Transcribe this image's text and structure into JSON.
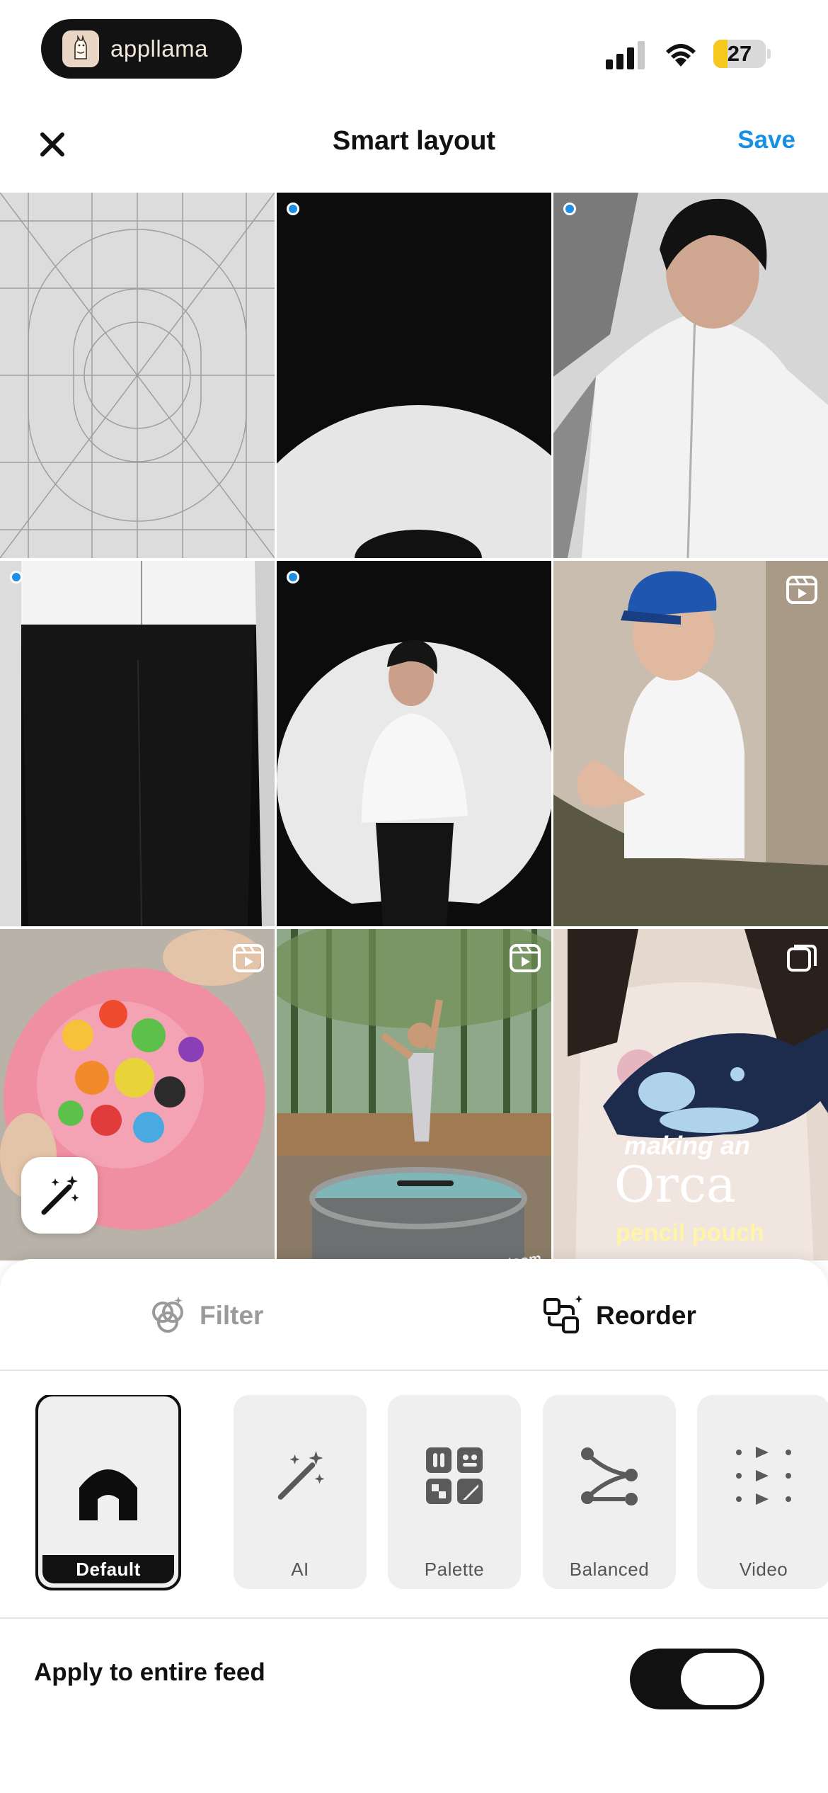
{
  "status_bar": {
    "app_name": "appllama",
    "battery_level": 27,
    "battery_percent_fill": 0.27
  },
  "header": {
    "title": "Smart layout",
    "save_label": "Save",
    "close_icon": "close-icon"
  },
  "grid": {
    "tiles": [
      {
        "kind": "placeholder-grid",
        "selected": false,
        "badge": null
      },
      {
        "kind": "photo-dark-spotlight-top",
        "selected": true,
        "badge": null
      },
      {
        "kind": "photo-man-white-shirt",
        "selected": true,
        "badge": null
      },
      {
        "kind": "photo-torso-dark-pants",
        "selected": true,
        "badge": null
      },
      {
        "kind": "photo-man-spotlight",
        "selected": true,
        "badge": null
      },
      {
        "kind": "photo-man-blue-cap",
        "selected": false,
        "badge": "reel-icon"
      },
      {
        "kind": "photo-candy-plate",
        "selected": false,
        "badge": "reel-icon"
      },
      {
        "kind": "photo-skater-pool",
        "selected": false,
        "badge": "reel-icon"
      },
      {
        "kind": "photo-orca-pouch",
        "selected": false,
        "badge": "carousel-icon"
      }
    ],
    "orca_caption_1": "making an",
    "orca_caption_2": "Orca",
    "orca_caption_3": "pencil pouch",
    "tank_brand": "Hastsom"
  },
  "sheet": {
    "tabs": [
      {
        "label": "Filter",
        "icon": "filter-icon",
        "active": false
      },
      {
        "label": "Reorder",
        "icon": "reorder-icon",
        "active": true
      }
    ],
    "layouts": [
      {
        "label": "Default",
        "icon": "home-icon",
        "selected": true
      },
      {
        "label": "AI",
        "icon": "magic-wand-icon",
        "selected": false
      },
      {
        "label": "Palette",
        "icon": "palette-icon",
        "selected": false
      },
      {
        "label": "Balanced",
        "icon": "balanced-icon",
        "selected": false
      },
      {
        "label": "Video",
        "icon": "video-grid-icon",
        "selected": false
      }
    ],
    "apply_label": "Apply to entire feed",
    "apply_toggle_on": true
  },
  "colors": {
    "accent": "#1890e6",
    "selection_dot": "#1e8fe6",
    "toggle_on": "#111111"
  }
}
